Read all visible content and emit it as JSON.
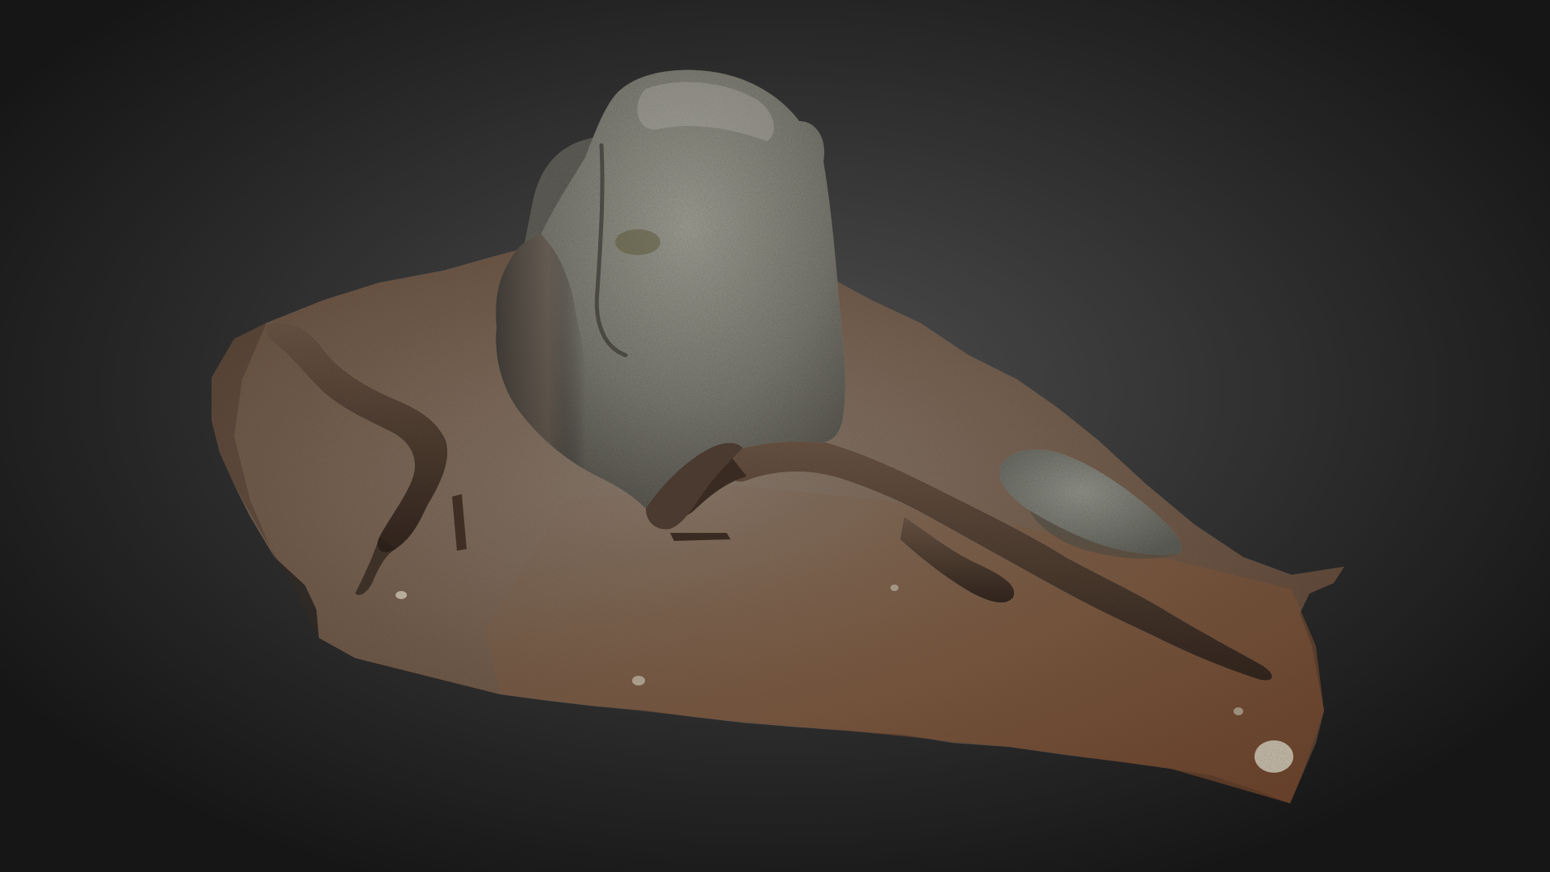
{
  "viewer": {
    "background_center": "#4e4e4e",
    "background_edge": "#161616"
  },
  "scene": {
    "subject": "boulder-on-forest-floor",
    "colors": {
      "ground_light": "#8a7a6c",
      "ground_mid": "#6e5646",
      "ground_dark": "#4a3528",
      "needles": "#7a5538",
      "rock_light": "#8f8f86",
      "rock_mid": "#6c6c64",
      "rock_dark": "#3e3d38",
      "root": "#4d3a2e",
      "root_dark": "#2e221b",
      "small_stone": "#bdb4a4"
    }
  }
}
